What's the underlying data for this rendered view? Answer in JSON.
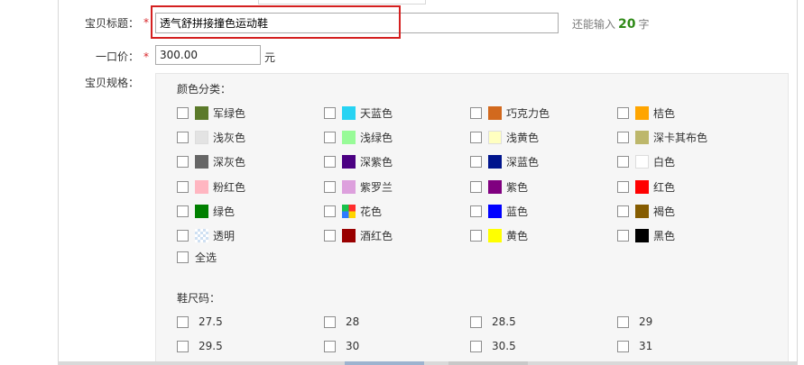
{
  "title_field": {
    "label": "宝贝标题：",
    "required_mark": "*",
    "value": "透气舒拼接撞色运动鞋",
    "remain_prefix": "还能输入",
    "remain_count": "20",
    "remain_suffix": "字"
  },
  "price_field": {
    "label": "一口价：",
    "required_mark": "*",
    "value": "300.00",
    "unit": "元"
  },
  "spec": {
    "label": "宝贝规格：",
    "color_section_title": "颜色分类：",
    "colors": [
      {
        "label": "军绿色",
        "swatch": "#5b7a2a"
      },
      {
        "label": "天蓝色",
        "swatch": "#27d3f3"
      },
      {
        "label": "巧克力色",
        "swatch": "#d2691e"
      },
      {
        "label": "桔色",
        "swatch": "#ffa500"
      },
      {
        "label": "浅灰色",
        "swatch": "#e3e3e3"
      },
      {
        "label": "浅绿色",
        "swatch": "#98fb98"
      },
      {
        "label": "浅黄色",
        "swatch": "#ffffc0"
      },
      {
        "label": "深卡其布色",
        "swatch": "#bdb76b"
      },
      {
        "label": "深灰色",
        "swatch": "#666666"
      },
      {
        "label": "深紫色",
        "swatch": "#4b0082"
      },
      {
        "label": "深蓝色",
        "swatch": "#00148c"
      },
      {
        "label": "白色",
        "swatch": "#ffffff"
      },
      {
        "label": "粉红色",
        "swatch": "#ffb6c1"
      },
      {
        "label": "紫罗兰",
        "swatch": "#dda0dd"
      },
      {
        "label": "紫色",
        "swatch": "#800080"
      },
      {
        "label": "红色",
        "swatch": "#ff0000"
      },
      {
        "label": "绿色",
        "swatch": "#008000"
      },
      {
        "label": "花色",
        "swatch": "multicolor"
      },
      {
        "label": "蓝色",
        "swatch": "#0000ff"
      },
      {
        "label": "褐色",
        "swatch": "#855c00"
      },
      {
        "label": "透明",
        "swatch": "transparent-checker"
      },
      {
        "label": "酒红色",
        "swatch": "#990000"
      },
      {
        "label": "黄色",
        "swatch": "#ffff00"
      },
      {
        "label": "黑色",
        "swatch": "#000000"
      }
    ],
    "select_all_label": "全选",
    "size_section_title": "鞋尺码：",
    "sizes": [
      "27.5",
      "28",
      "28.5",
      "29",
      "29.5",
      "30",
      "30.5",
      "31"
    ]
  }
}
